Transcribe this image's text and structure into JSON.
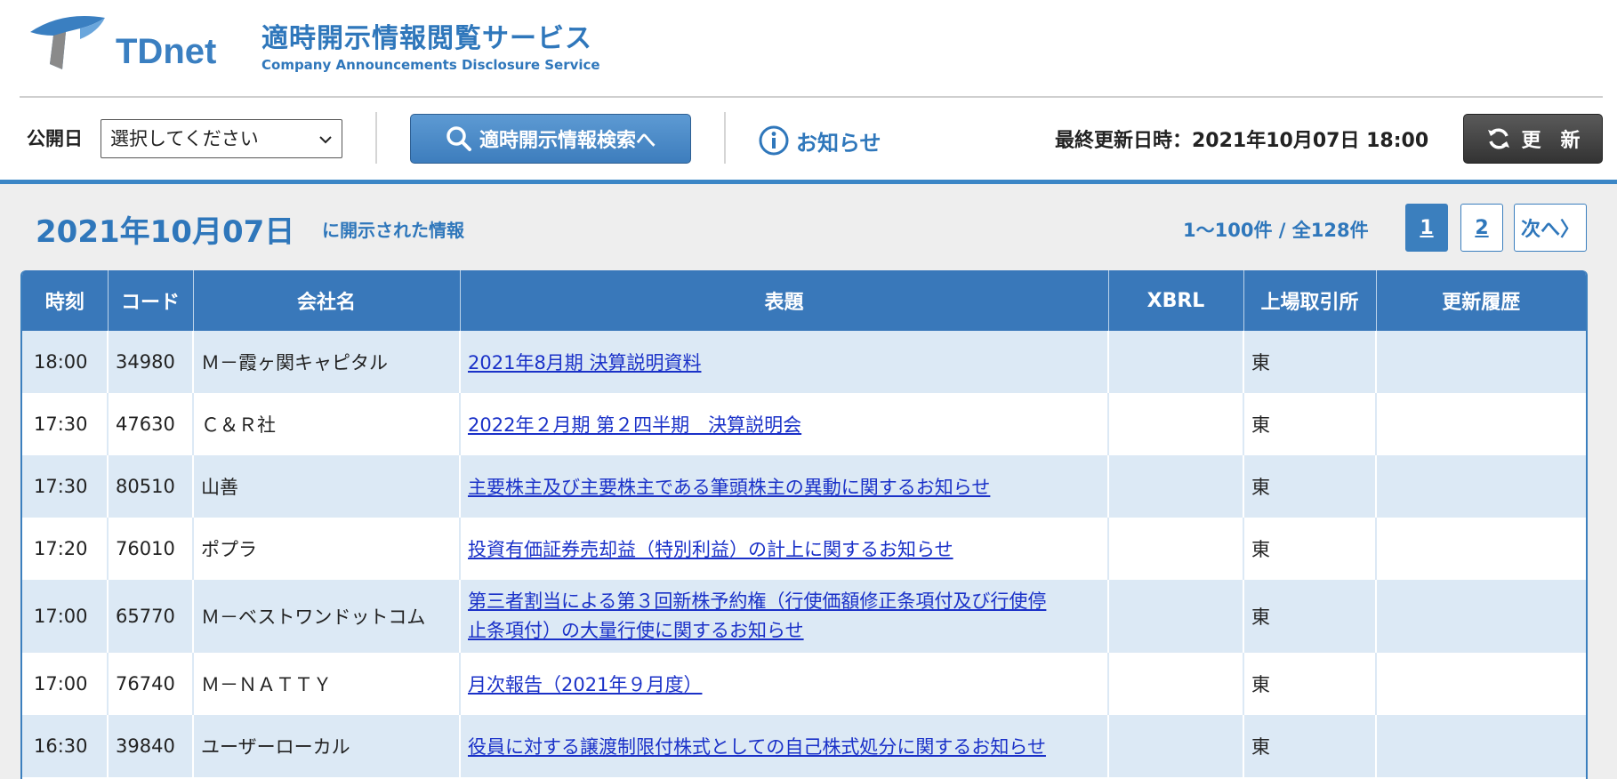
{
  "header": {
    "logo_text": "TDnet",
    "service_title": "適時開示情報閲覧サービス",
    "service_subtitle": "Company Announcements Disclosure Service"
  },
  "toolbar": {
    "pub_date_label": "公開日",
    "date_select_value": "選択してください",
    "search_button_label": "適時開示情報検索へ",
    "notice_label": "お知らせ",
    "last_updated": "最終更新日時：2021年10月07日 18:00",
    "refresh_label": "更　新"
  },
  "listing": {
    "date": "2021年10月07日",
    "date_suffix": "に開示された情報",
    "range": "1〜100件 / 全128件",
    "pages": [
      "1",
      "2"
    ],
    "next_label": "次へ〉"
  },
  "table": {
    "headers": [
      "時刻",
      "コード",
      "会社名",
      "表題",
      "XBRL",
      "上場取引所",
      "更新履歴"
    ],
    "rows": [
      {
        "time": "18:00",
        "code": "34980",
        "company": "Ｍ－霞ヶ関キャピタル",
        "title": "2021年8月期 決算説明資料",
        "xbrl": "",
        "exchange": "東",
        "history": ""
      },
      {
        "time": "17:30",
        "code": "47630",
        "company": "Ｃ＆Ｒ社",
        "title": "2022年２月期 第２四半期　決算説明会",
        "xbrl": "",
        "exchange": "東",
        "history": ""
      },
      {
        "time": "17:30",
        "code": "80510",
        "company": "山善",
        "title": "主要株主及び主要株主である筆頭株主の異動に関するお知らせ",
        "xbrl": "",
        "exchange": "東",
        "history": ""
      },
      {
        "time": "17:20",
        "code": "76010",
        "company": "ポプラ",
        "title": "投資有価証券売却益（特別利益）の計上に関するお知らせ",
        "xbrl": "",
        "exchange": "東",
        "history": ""
      },
      {
        "time": "17:00",
        "code": "65770",
        "company": "Ｍ－ベストワンドットコム",
        "title_line1": "第三者割当による第３回新株予約権（行使価額修正条項付及び行使停",
        "title_line2": "止条項付）の大量行使に関するお知らせ",
        "xbrl": "",
        "exchange": "東",
        "history": ""
      },
      {
        "time": "17:00",
        "code": "76740",
        "company": "Ｍ－ＮＡＴＴＹ",
        "title": "月次報告（2021年９月度）",
        "xbrl": "",
        "exchange": "東",
        "history": ""
      },
      {
        "time": "16:30",
        "code": "39840",
        "company": "ユーザーローカル",
        "title": "役員に対する譲渡制限付株式としての自己株式処分に関するお知らせ",
        "xbrl": "",
        "exchange": "東",
        "history": ""
      }
    ]
  },
  "colors": {
    "brand_blue": "#3978ba",
    "link_blue": "#1a31c8",
    "row_alt": "#dce9f5"
  },
  "icons": {
    "search": "search-icon",
    "info": "info-icon",
    "refresh": "refresh-icon",
    "chevron": "chevron-down-icon"
  }
}
